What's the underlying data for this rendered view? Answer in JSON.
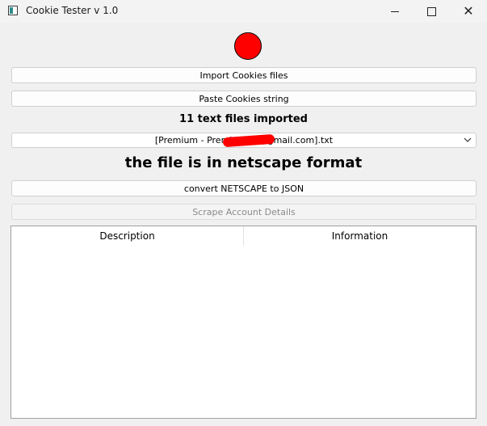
{
  "window": {
    "title": "Cookie Tester v 1.0",
    "minimize_icon": "minimize-icon",
    "maximize_icon": "maximize-icon",
    "close_icon": "close-icon"
  },
  "status_indicator": {
    "color": "#ff0000"
  },
  "buttons": {
    "import": "Import Cookies files",
    "paste": "Paste Cookies string",
    "convert": "convert NETSCAPE to JSON",
    "scrape": "Scrape Account Details"
  },
  "imported_label": "11 text files imported",
  "file_select": {
    "selected": "[Premium - Premium] [                @gmail.com].txt",
    "arrow_icon": "chevron-down-icon"
  },
  "format_label": "the file is in netscape format",
  "table": {
    "columns": [
      "Description",
      "Information"
    ],
    "rows": []
  }
}
